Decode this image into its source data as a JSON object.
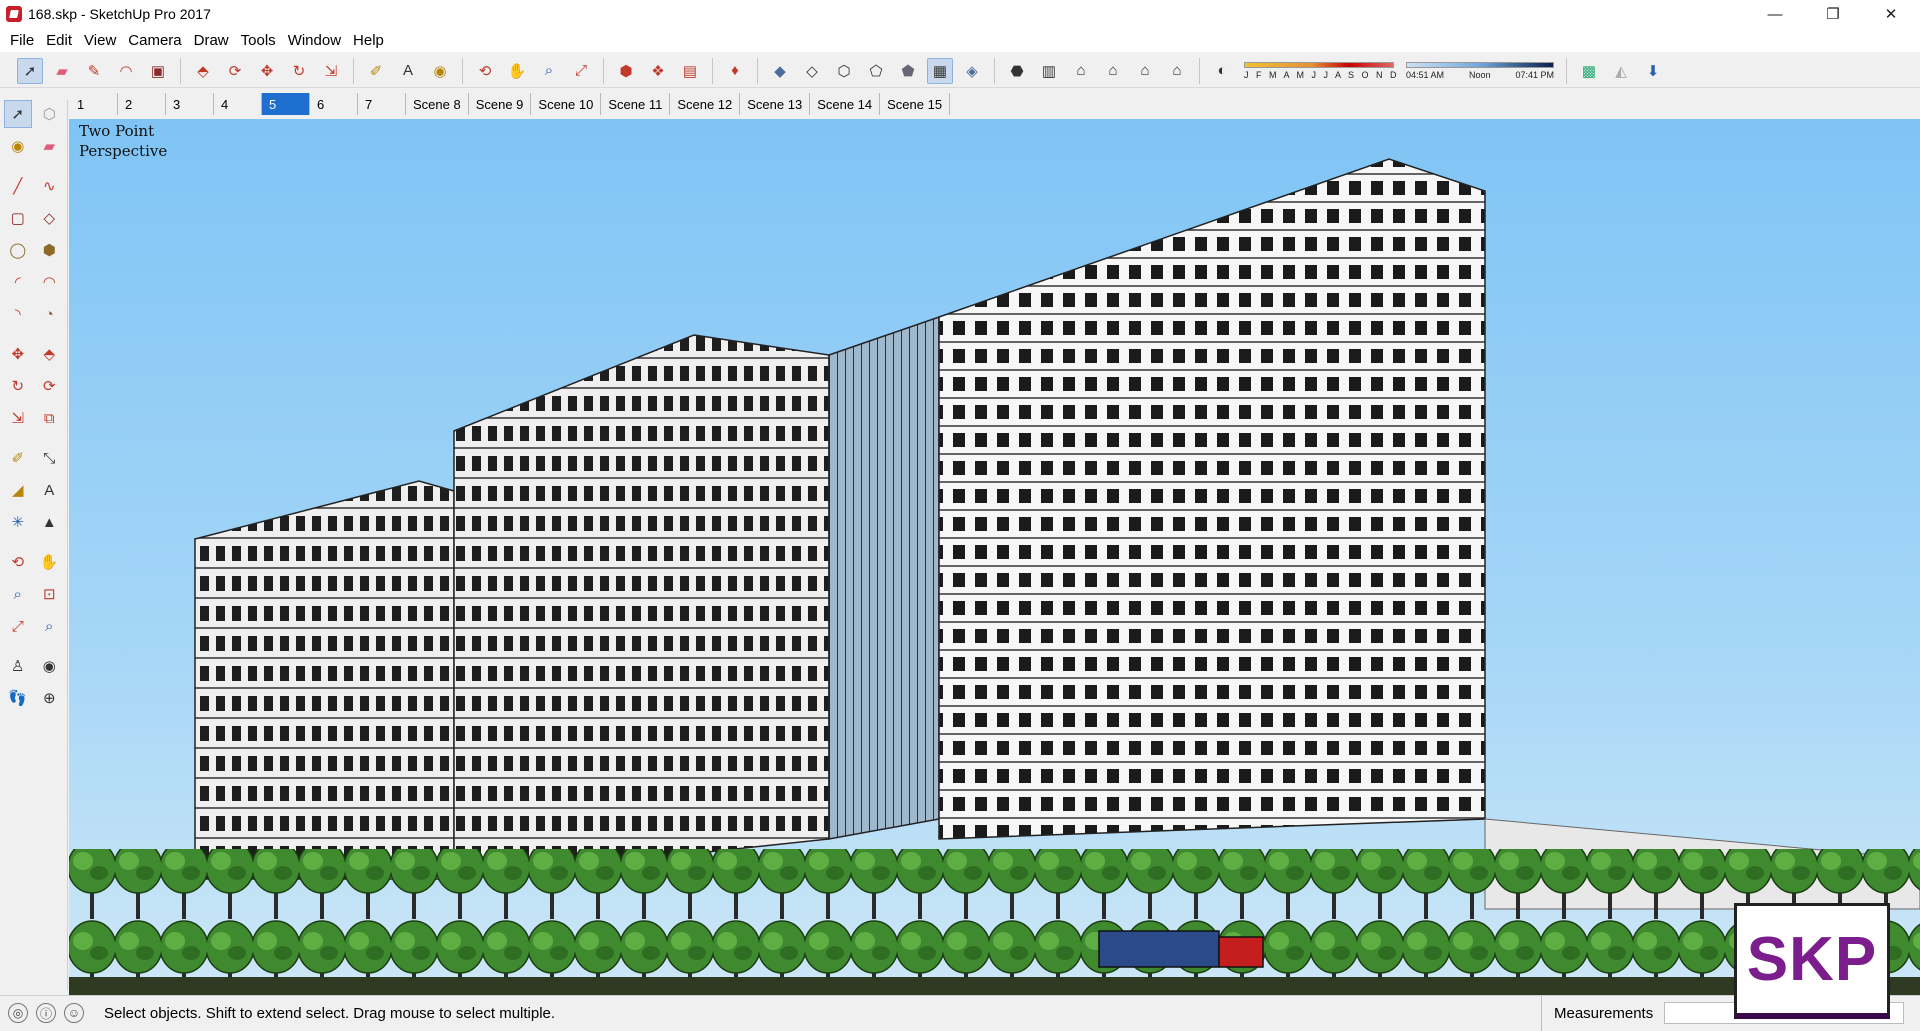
{
  "window": {
    "title": "168.skp - SketchUp Pro 2017",
    "minimize": "—",
    "maximize": "❐",
    "close": "✕"
  },
  "menu": [
    "File",
    "Edit",
    "View",
    "Camera",
    "Draw",
    "Tools",
    "Window",
    "Help"
  ],
  "shadow_settings": {
    "months_label": "J F M A M J J A S O N D",
    "time_start": "04:51 AM",
    "time_mid": "Noon",
    "time_end": "07:41 PM"
  },
  "scenes": [
    "1",
    "2",
    "3",
    "4",
    "5",
    "6",
    "7",
    "Scene 8",
    "Scene 9",
    "Scene 10",
    "Scene 11",
    "Scene 12",
    "Scene 13",
    "Scene 14",
    "Scene 15"
  ],
  "active_scene": "5",
  "viewport": {
    "camera_line1": "Two Point",
    "camera_line2": "Perspective"
  },
  "status": {
    "message": "Select objects. Shift to extend select. Drag mouse to select multiple.",
    "measurements_label": "Measurements",
    "measurements_value": ""
  },
  "watermark": "SKP",
  "icons": {
    "select": "select-arrow-icon",
    "eraser": "eraser-icon",
    "pencil": "pencil-icon",
    "paint": "paint-bucket-icon",
    "orbit": "orbit-icon"
  }
}
